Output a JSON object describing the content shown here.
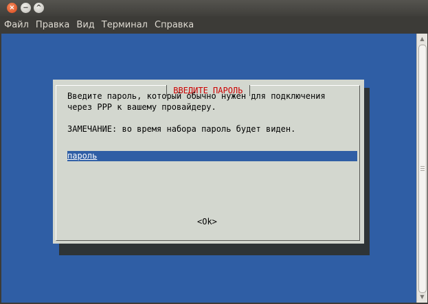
{
  "window": {
    "close_glyph": "×",
    "minimize_glyph": "−",
    "maximize_glyph": "^"
  },
  "menubar": {
    "items": [
      "Файл",
      "Правка",
      "Вид",
      "Терминал",
      "Справка"
    ]
  },
  "dialog": {
    "title": " ВВЕДИТЕ ПАРОЛЬ ",
    "line1": "Введите пароль, который обычно нужен для подключения",
    "line2": "через PPP к вашему провайдеру.",
    "note": "ЗАМЕЧАНИЕ: во время набора пароль будет виден.",
    "input_value": "пароль",
    "ok_label": "<Ok>"
  },
  "colors": {
    "terminal_bg": "#2f5ea5",
    "dialog_bg": "#d3d7cf",
    "title_text": "#cc0000",
    "input_bg": "#2f5ea5",
    "input_text": "#ffffff",
    "shadow": "#2e3436"
  },
  "icons": [
    "close-icon",
    "minimize-icon",
    "maximize-icon",
    "scroll-up-icon",
    "scroll-down-icon"
  ]
}
